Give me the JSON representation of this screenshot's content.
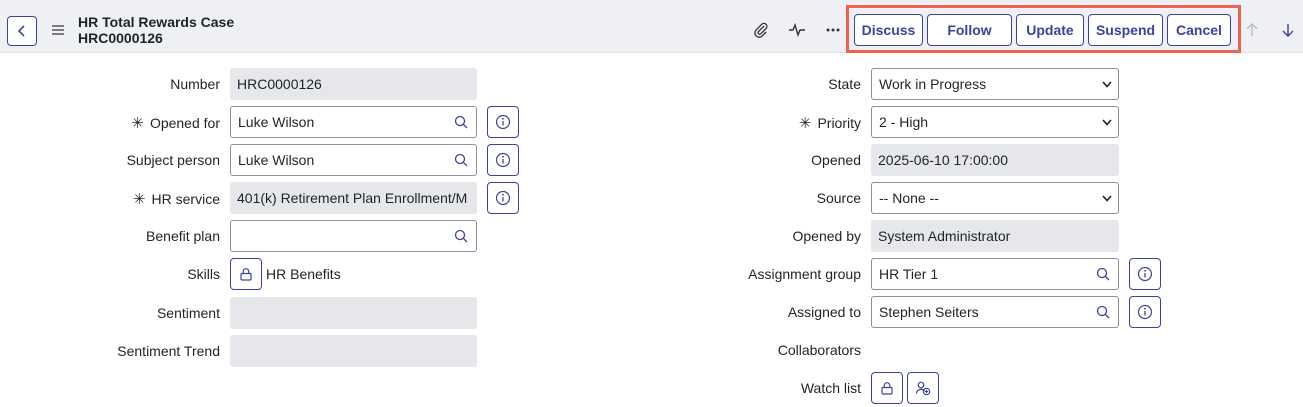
{
  "header": {
    "title": "HR Total Rewards Case",
    "number": "HRC0000126",
    "actions": [
      "Discuss",
      "Follow",
      "Update",
      "Suspend",
      "Cancel"
    ]
  },
  "left": {
    "number": {
      "label": "Number",
      "value": "HRC0000126"
    },
    "opened_for": {
      "label": "Opened for",
      "value": "Luke Wilson"
    },
    "subject_person": {
      "label": "Subject person",
      "value": "Luke Wilson"
    },
    "hr_service": {
      "label": "HR service",
      "value": "401(k) Retirement Plan Enrollment/M"
    },
    "benefit_plan": {
      "label": "Benefit plan",
      "value": ""
    },
    "skills": {
      "label": "Skills",
      "value": "HR Benefits"
    },
    "sentiment": {
      "label": "Sentiment",
      "value": ""
    },
    "sentiment_trend": {
      "label": "Sentiment Trend",
      "value": ""
    }
  },
  "right": {
    "state": {
      "label": "State",
      "value": "Work in Progress"
    },
    "priority": {
      "label": "Priority",
      "value": "2 - High"
    },
    "opened": {
      "label": "Opened",
      "value": "2025-06-10 17:00:00"
    },
    "source": {
      "label": "Source",
      "value": "-- None --"
    },
    "opened_by": {
      "label": "Opened by",
      "value": "System Administrator"
    },
    "assignment_group": {
      "label": "Assignment group",
      "value": "HR Tier 1"
    },
    "assigned_to": {
      "label": "Assigned to",
      "value": "Stephen Seiters"
    },
    "collaborators": {
      "label": "Collaborators"
    },
    "watch_list": {
      "label": "Watch list"
    }
  },
  "required_mark": "✳",
  "colors": {
    "accent": "#3a43a1",
    "highlight": "#f06152",
    "readonly_bg": "#e6e7ea"
  }
}
